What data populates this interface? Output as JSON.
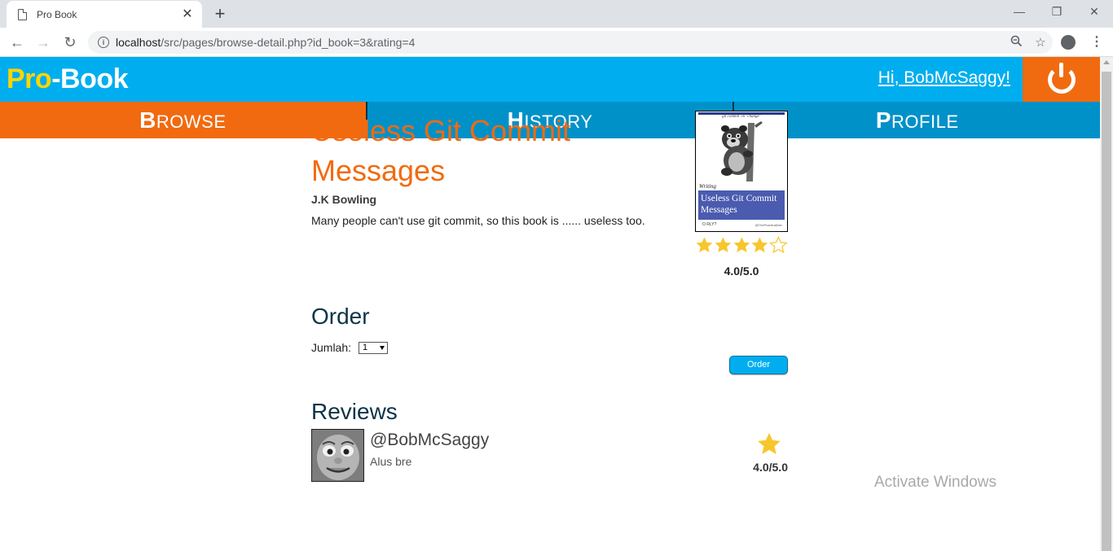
{
  "browser": {
    "tab_title": "Pro Book",
    "url_host": "localhost",
    "url_path": "/src/pages/browse-detail.php?id_book=3&rating=4"
  },
  "header": {
    "logo_pro": "Pro",
    "logo_book": "-Book",
    "greeting": "Hi, BobMcSaggy!"
  },
  "nav": {
    "items": [
      {
        "label": "BROWSE",
        "active": true
      },
      {
        "label": "HISTORY",
        "active": false
      },
      {
        "label": "PROFILE",
        "active": false
      }
    ]
  },
  "book": {
    "title": "Useless Git Commit Messages",
    "author": "J.K Bowling",
    "description": "Many people can't use git commit, so this book is ...... useless too.",
    "rating": 4.0,
    "rating_text": "4.0/5.0",
    "cover": {
      "tagline": "git commit -m \"change\"",
      "writing": "Writing",
      "title": "Useless Git Commit Messages",
      "publisher": "O RLY?",
      "author": "@ThePracticalDev"
    }
  },
  "order": {
    "heading": "Order",
    "quantity_label": "Jumlah:",
    "quantity_value": "1",
    "button_label": "Order"
  },
  "reviews": {
    "heading": "Reviews",
    "items": [
      {
        "user": "@BobMcSaggy",
        "comment": "Alus bre",
        "rating_text": "4.0/5.0"
      }
    ]
  },
  "watermark": "Activate Windows",
  "colors": {
    "header_blue": "#00aeef",
    "nav_blue": "#0091c9",
    "accent_orange": "#f26a0f",
    "logo_yellow": "#ffd500",
    "heading_dark": "#0d3447",
    "star_gold": "#f7c62b"
  }
}
